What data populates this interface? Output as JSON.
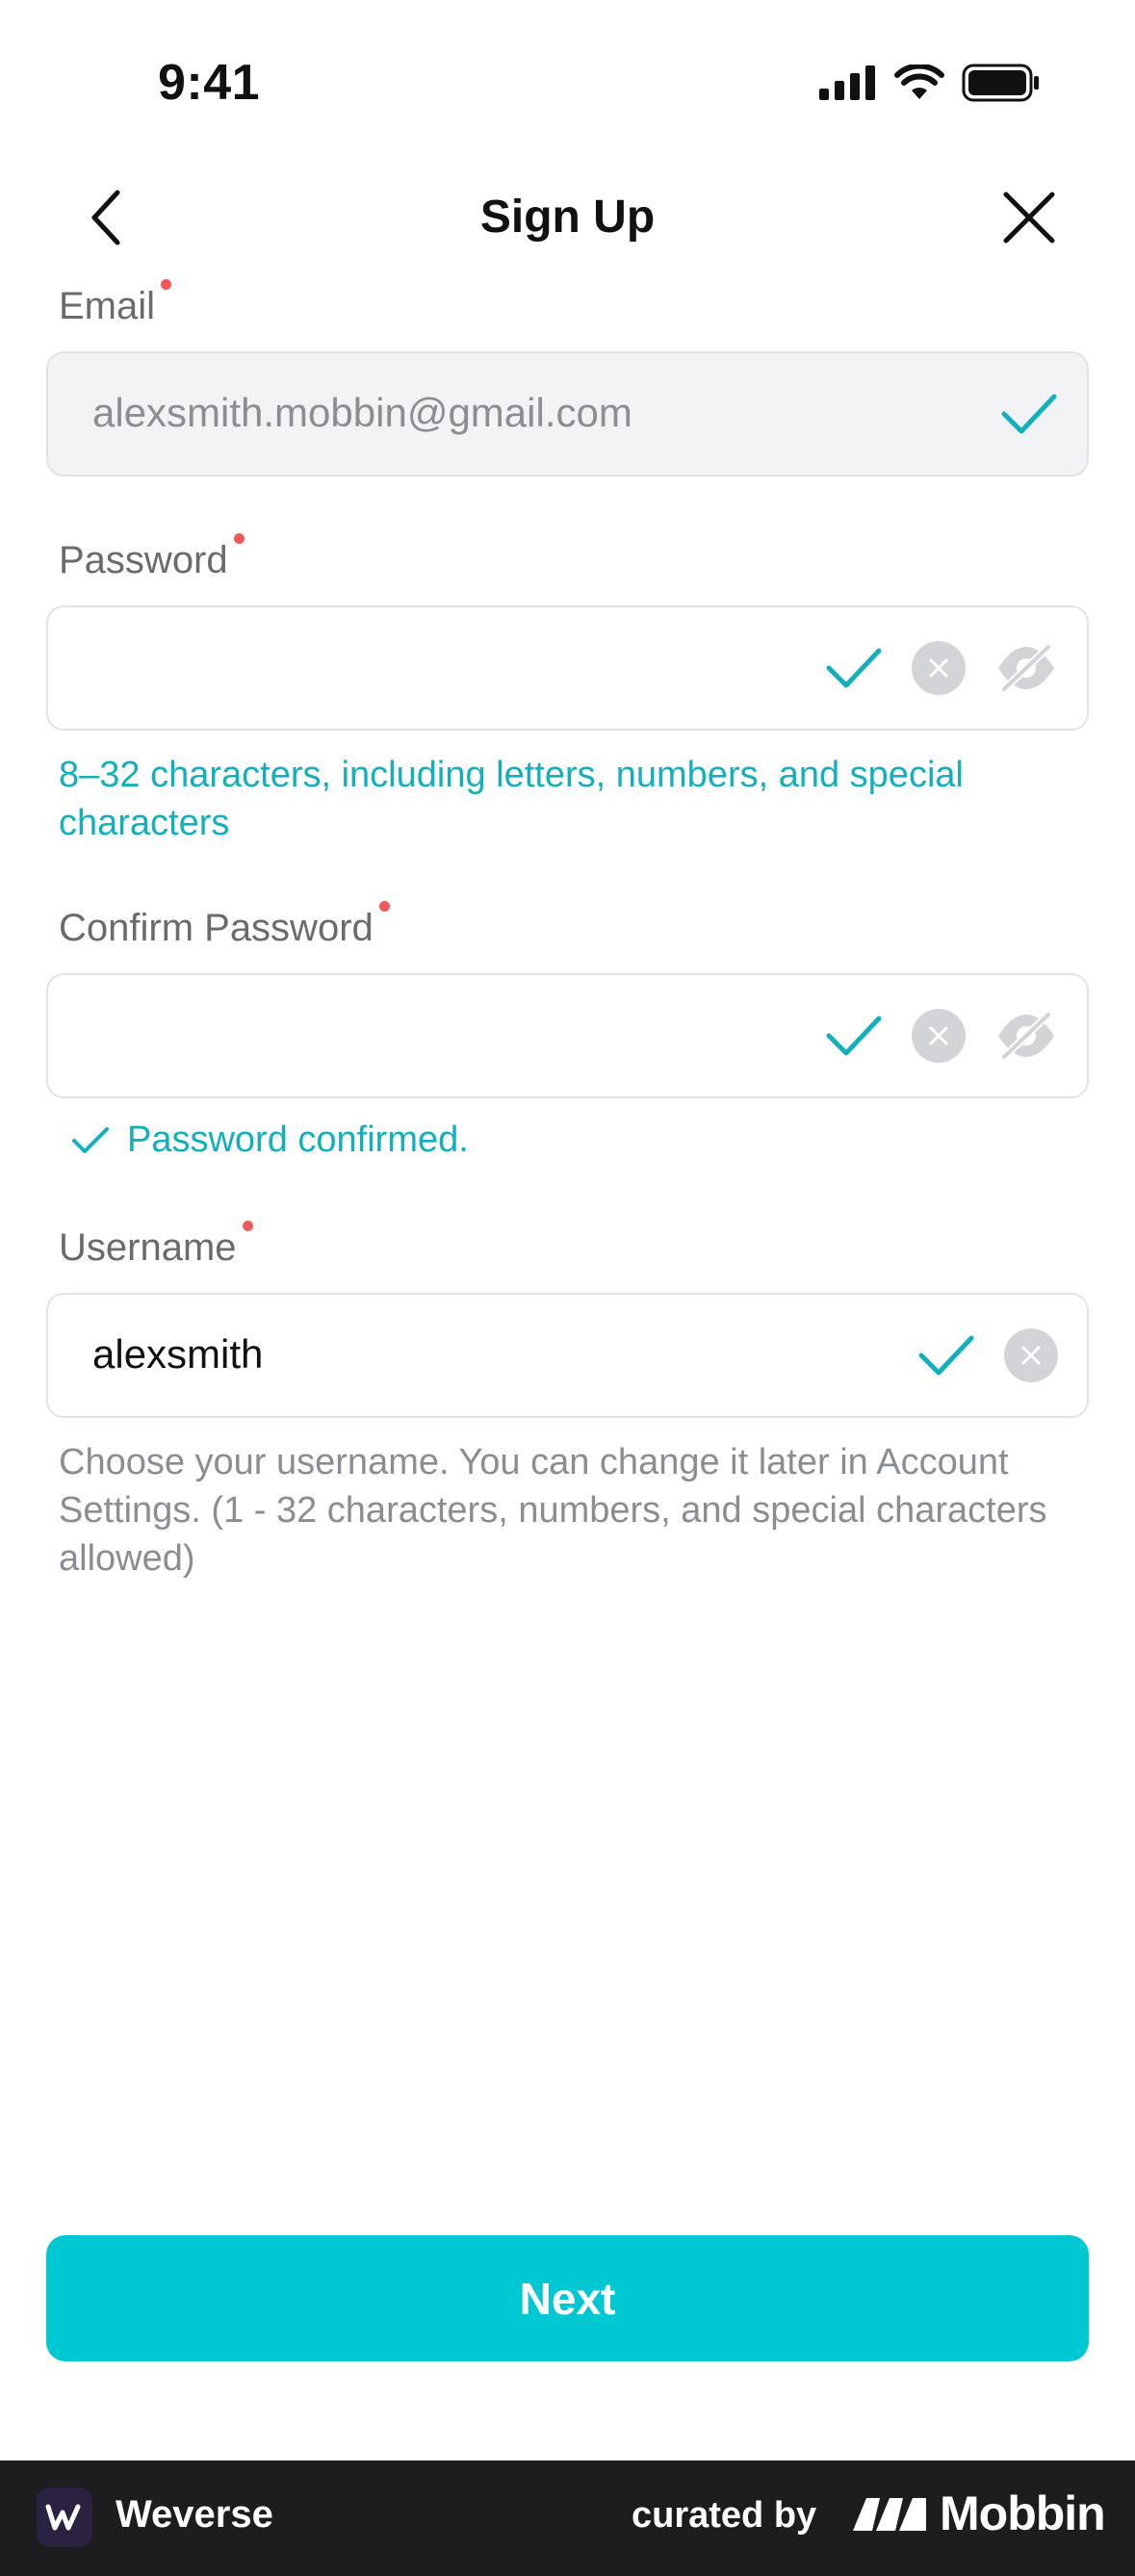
{
  "status_bar": {
    "time": "9:41"
  },
  "nav": {
    "title": "Sign Up"
  },
  "form": {
    "email": {
      "label": "Email",
      "value": "alexsmith.mobbin@gmail.com"
    },
    "password": {
      "label": "Password",
      "hint": "8–32 characters, including letters, numbers, and special characters"
    },
    "confirm_password": {
      "label": "Confirm Password",
      "status": "Password confirmed."
    },
    "username": {
      "label": "Username",
      "value": "alexsmith",
      "hint": "Choose your username. You can change it later in Account Settings. (1 - 32 characters, numbers, and special characters allowed)"
    }
  },
  "actions": {
    "next_label": "Next"
  },
  "footer": {
    "brand": "Weverse",
    "curated_by": "curated by",
    "mobbin": "Mobbin"
  },
  "colors": {
    "accent": "#00c8d2",
    "success": "#12b0bd",
    "required": "#f05a5a"
  }
}
